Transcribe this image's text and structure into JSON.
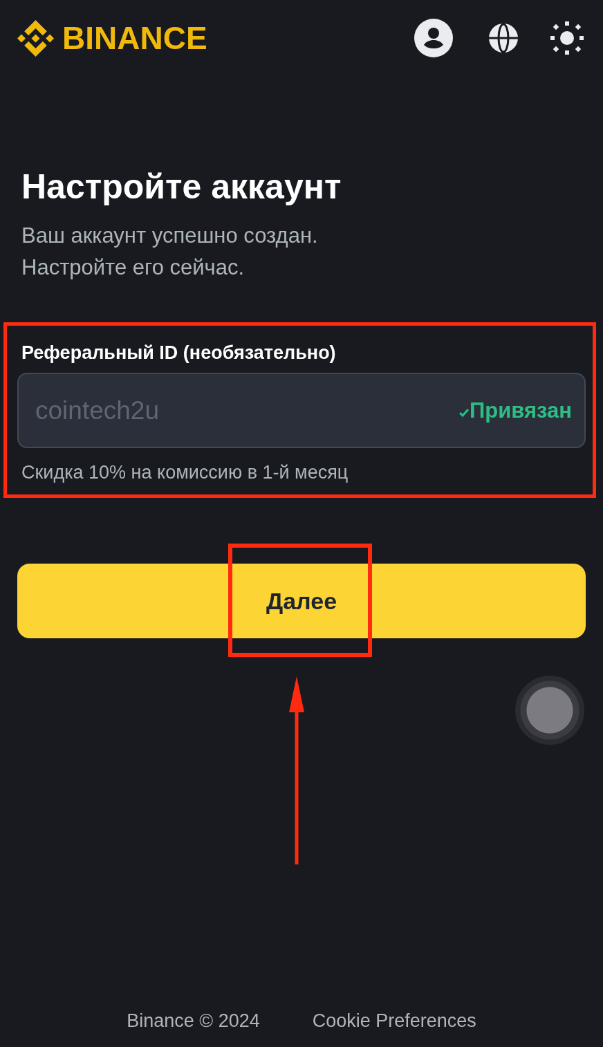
{
  "header": {
    "logo_text": "BINANCE"
  },
  "page": {
    "title": "Настройте аккаунт",
    "subtitle_lines": [
      "Ваш аккаунт успешно создан.",
      "Настройте его сейчас."
    ]
  },
  "referral": {
    "label": "Реферальный ID (необязательно)",
    "value": "cointech2u",
    "disabled": true,
    "status": "Привязан",
    "hint": "Скидка 10% на комиссию в 1-й месяц",
    "highlighted": true
  },
  "next_button": {
    "label": "Далее",
    "highlighted": true
  },
  "pointer_arrow": true,
  "footer": {
    "links": [
      "Binance © 2024",
      "Cookie Preferences"
    ]
  }
}
